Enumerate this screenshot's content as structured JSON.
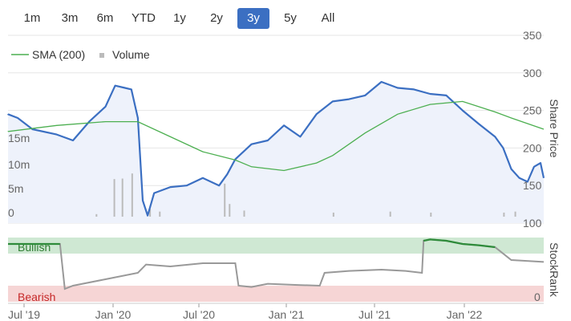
{
  "range_buttons": [
    {
      "label": "1m",
      "active": false
    },
    {
      "label": "3m",
      "active": false
    },
    {
      "label": "6m",
      "active": false
    },
    {
      "label": "YTD",
      "active": false
    },
    {
      "label": "1y",
      "active": false
    },
    {
      "label": "2y",
      "active": false
    },
    {
      "label": "3y",
      "active": true
    },
    {
      "label": "5y",
      "active": false
    },
    {
      "label": "All",
      "active": false
    }
  ],
  "legend": {
    "sma_label": "SMA (200)",
    "volume_label": "Volume"
  },
  "colors": {
    "price": "#3b6fc2",
    "sma": "#4caf50",
    "volume": "#bbbbbb",
    "bullish_band": "#cfe8d3",
    "bearish_band": "#f6d5d5",
    "stockrank": "#999999",
    "stockrank_bullish": "#2e8b3a",
    "active_button": "#3b6fc2"
  },
  "chart_data": {
    "type": "line",
    "x_tick_labels": [
      "Jul '19",
      "Jan '20",
      "Jul '20",
      "Jan '21",
      "Jul '21",
      "Jan '22"
    ],
    "share_price": {
      "axis_title": "Share Price",
      "ticks": [
        100,
        150,
        200,
        250,
        300,
        350
      ],
      "ylim": [
        100,
        350
      ],
      "points": [
        [
          0,
          245
        ],
        [
          0.6,
          240
        ],
        [
          1.5,
          225
        ],
        [
          3,
          218
        ],
        [
          4,
          210
        ],
        [
          5,
          235
        ],
        [
          6,
          255
        ],
        [
          6.6,
          283
        ],
        [
          7.2,
          280
        ],
        [
          7.6,
          278
        ],
        [
          8,
          240
        ],
        [
          8.3,
          130
        ],
        [
          8.6,
          110
        ],
        [
          9,
          140
        ],
        [
          10,
          148
        ],
        [
          11,
          150
        ],
        [
          12,
          160
        ],
        [
          13,
          150
        ],
        [
          13.5,
          165
        ],
        [
          14,
          185
        ],
        [
          15,
          205
        ],
        [
          16,
          210
        ],
        [
          17,
          230
        ],
        [
          18,
          215
        ],
        [
          19,
          245
        ],
        [
          20,
          262
        ],
        [
          21,
          265
        ],
        [
          22,
          270
        ],
        [
          23,
          288
        ],
        [
          24,
          280
        ],
        [
          25,
          278
        ],
        [
          26,
          272
        ],
        [
          27,
          270
        ],
        [
          28,
          250
        ],
        [
          29,
          232
        ],
        [
          30,
          215
        ],
        [
          30.5,
          200
        ],
        [
          31,
          172
        ],
        [
          31.5,
          160
        ],
        [
          32,
          155
        ],
        [
          32.4,
          175
        ],
        [
          32.8,
          180
        ],
        [
          33,
          160
        ]
      ]
    },
    "sma": {
      "name": "SMA (200)",
      "points": [
        [
          0,
          222
        ],
        [
          3,
          230
        ],
        [
          6,
          235
        ],
        [
          8,
          235
        ],
        [
          10,
          215
        ],
        [
          12,
          195
        ],
        [
          14,
          184
        ],
        [
          15,
          175
        ],
        [
          17,
          170
        ],
        [
          19,
          180
        ],
        [
          20,
          190
        ],
        [
          22,
          220
        ],
        [
          24,
          245
        ],
        [
          26,
          258
        ],
        [
          28,
          262
        ],
        [
          30,
          248
        ],
        [
          31,
          240
        ],
        [
          33,
          225
        ]
      ]
    },
    "volume": {
      "axis_title": "Volume",
      "ticks": [
        "0",
        "5m",
        "10m",
        "15m"
      ],
      "bars": [
        [
          5.4,
          0.5
        ],
        [
          6.5,
          7.4
        ],
        [
          7,
          7.5
        ],
        [
          7.6,
          8.5
        ],
        [
          8.7,
          1.5
        ],
        [
          9.3,
          1.0
        ],
        [
          13.3,
          6.5
        ],
        [
          13.6,
          2.5
        ],
        [
          14.5,
          1.2
        ],
        [
          20,
          0.8
        ],
        [
          23.5,
          1.0
        ],
        [
          26,
          0.8
        ],
        [
          30.5,
          0.8
        ],
        [
          31.2,
          1.0
        ]
      ]
    },
    "stockrank": {
      "axis_title": "StockRank",
      "band_bullish": "Bullish",
      "band_bearish": "Bearish",
      "tick_bottom": "0",
      "points": [
        [
          0,
          90
        ],
        [
          3.2,
          90
        ],
        [
          3.5,
          20
        ],
        [
          4,
          25
        ],
        [
          6,
          35
        ],
        [
          8,
          45
        ],
        [
          8.5,
          58
        ],
        [
          10,
          55
        ],
        [
          12,
          60
        ],
        [
          14,
          60
        ],
        [
          14.2,
          25
        ],
        [
          15,
          23
        ],
        [
          16,
          28
        ],
        [
          18,
          26
        ],
        [
          19.2,
          25
        ],
        [
          19.5,
          45
        ],
        [
          21,
          48
        ],
        [
          23,
          50
        ],
        [
          24.5,
          48
        ],
        [
          25.5,
          45
        ],
        [
          25.6,
          95
        ],
        [
          26,
          97
        ],
        [
          27,
          95
        ],
        [
          28,
          90
        ],
        [
          29,
          88
        ],
        [
          30,
          85
        ],
        [
          31,
          65
        ],
        [
          33,
          62
        ]
      ]
    }
  }
}
